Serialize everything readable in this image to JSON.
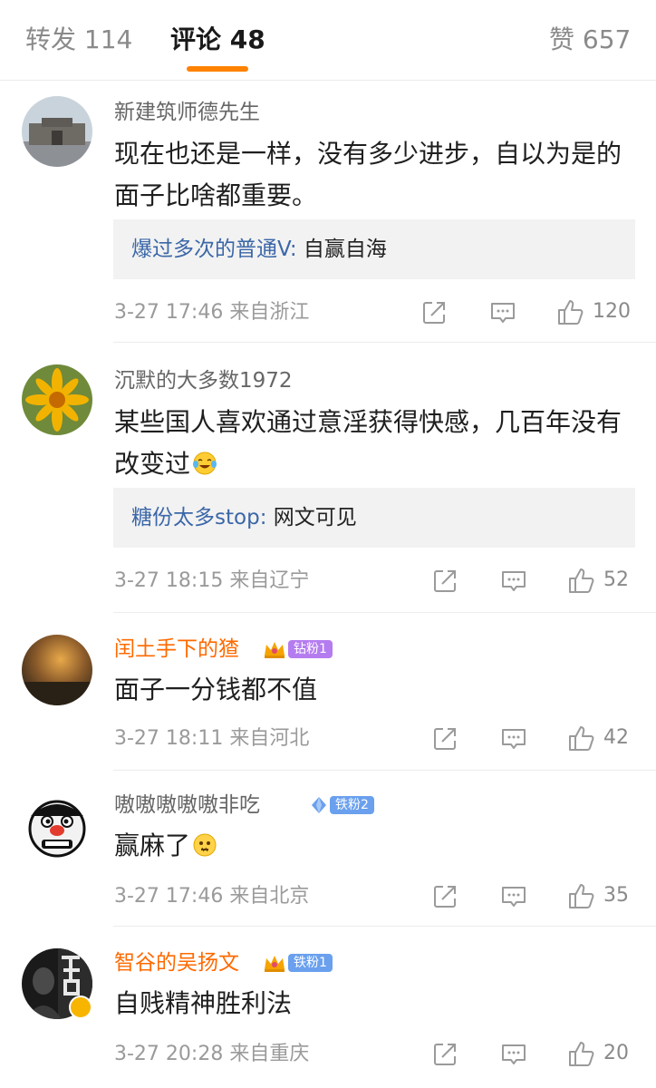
{
  "tabs": {
    "repost_label": "转发 114",
    "comment_label": "评论 48",
    "like_label": "赞 657"
  },
  "comments": [
    {
      "username": "新建筑师德先生",
      "text": "现在也还是一样，没有多少进步，自以为是的面子比啥都重要。",
      "reply_user": "爆过多次的普通V",
      "reply_colon": ":",
      "reply_text": "自赢自海",
      "time": "3-27 17:46",
      "location": "来自浙江",
      "likes": "120"
    },
    {
      "username": "沉默的大多数1972",
      "text": "某些国人喜欢通过意淫获得快感，几百年没有改变过",
      "emoji": "crying-laughing-emoji",
      "reply_user": "糖份太多stop",
      "reply_colon": ":",
      "reply_text": "网文可见",
      "time": "3-27 18:15",
      "location": "来自辽宁",
      "likes": "52"
    },
    {
      "username": "闰土手下的猹",
      "badge": "钻粉1",
      "badge_color": "#b57cf0",
      "text": "面子一分钱都不值",
      "time": "3-27 18:11",
      "location": "来自河北",
      "likes": "42"
    },
    {
      "username": "嗷嗷嗷嗷嗷非吃",
      "badge": "铁粉2",
      "badge_color": "#6aa0ee",
      "text": "赢麻了",
      "emoji": "speechless-emoji",
      "time": "3-27 17:46",
      "location": "来自北京",
      "likes": "35"
    },
    {
      "username": "智谷的吴扬文",
      "badge": "铁粉1",
      "badge_color": "#6aa0ee",
      "text": "自贱精神胜利法",
      "time": "3-27 20:28",
      "location": "来自重庆",
      "likes": "20"
    }
  ],
  "colors": {
    "accent": "#ff8200",
    "link": "#3b67a8",
    "vip_name": "#ff6a00"
  }
}
